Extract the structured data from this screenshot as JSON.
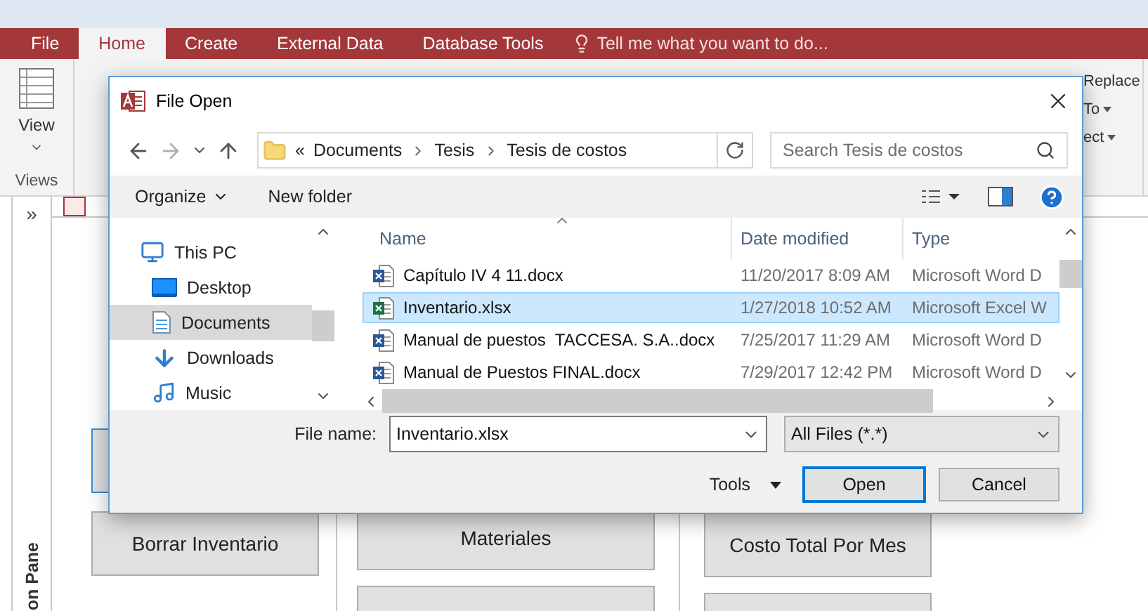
{
  "app": {
    "tabs": [
      {
        "label": "File",
        "selected": false
      },
      {
        "label": "Home",
        "selected": true
      },
      {
        "label": "Create",
        "selected": false
      },
      {
        "label": "External Data",
        "selected": false
      },
      {
        "label": "Database Tools",
        "selected": false
      }
    ],
    "tell_me": "Tell me what you want to do...",
    "ribbon": {
      "view_button": "View",
      "group_label": "Views",
      "fragments": [
        {
          "label": "Replace"
        },
        {
          "label": "To",
          "caret": true
        },
        {
          "label": "ect",
          "caret": true
        }
      ]
    }
  },
  "navigation_pane": {
    "toggle": "»",
    "label": "on Pane"
  },
  "form": {
    "columns": [
      {
        "buttons": [
          {
            "focused": true
          },
          {
            "label": "Borrar Inventario",
            "focused": false
          }
        ]
      },
      {
        "buttons": [
          {
            "label": "Materiales",
            "focused": false
          },
          {
            "focused": false
          }
        ]
      },
      {
        "buttons": [
          {
            "label": "Costo Total Por Mes",
            "focused": false
          },
          {
            "focused": false
          }
        ]
      }
    ]
  },
  "dialog": {
    "title": "File Open",
    "breadcrumb_prefix": "«",
    "breadcrumb": [
      "Documents",
      "Tesis",
      "Tesis de costos"
    ],
    "search": {
      "placeholder": "Search Tesis de costos"
    },
    "toolbar": {
      "organize": "Organize",
      "new_folder": "New folder"
    },
    "nav_items": [
      {
        "label": "This PC",
        "kind": "pc",
        "selected": false
      },
      {
        "label": "Desktop",
        "kind": "desktop",
        "selected": false
      },
      {
        "label": "Documents",
        "kind": "documents",
        "selected": true
      },
      {
        "label": "Downloads",
        "kind": "downloads",
        "selected": false
      },
      {
        "label": "Music",
        "kind": "music",
        "selected": false
      }
    ],
    "columns": [
      "Name",
      "Date modified",
      "Type"
    ],
    "files": [
      {
        "name": "Capítulo IV 4 11.docx",
        "date": "11/20/2017 8:09 AM",
        "type": "Microsoft Word D",
        "kind": "word",
        "selected": false
      },
      {
        "name": "Inventario.xlsx",
        "date": "1/27/2018 10:52 AM",
        "type": "Microsoft Excel W",
        "kind": "excel",
        "selected": true
      },
      {
        "name": "Manual de puestos  TACCESA. S.A..docx",
        "date": "7/25/2017 11:29 AM",
        "type": "Microsoft Word D",
        "kind": "word",
        "selected": false
      },
      {
        "name": "Manual de Puestos FINAL.docx",
        "date": "7/29/2017 12:42 PM",
        "type": "Microsoft Word D",
        "kind": "word",
        "selected": false
      }
    ],
    "file_name_label": "File name:",
    "file_name": "Inventario.xlsx",
    "filter": "All Files (*.*)",
    "tools": "Tools",
    "open": "Open",
    "cancel": "Cancel"
  }
}
